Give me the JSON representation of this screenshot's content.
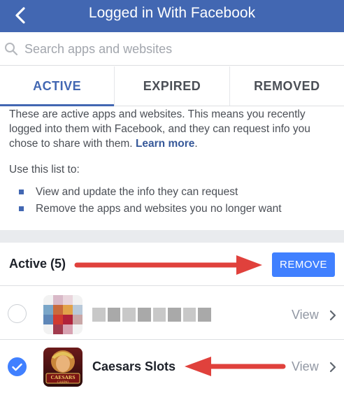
{
  "header": {
    "title": "Logged in With Facebook"
  },
  "search": {
    "placeholder": "Search apps and websites",
    "value": ""
  },
  "tabs": [
    {
      "label": "ACTIVE",
      "selected": true
    },
    {
      "label": "EXPIRED",
      "selected": false
    },
    {
      "label": "REMOVED",
      "selected": false
    }
  ],
  "intro": {
    "text": "These are active apps and websites. This means you recently logged into them with Facebook, and they can request info you chose to share with them.",
    "learn_more": "Learn more",
    "period": ".",
    "use_list_label": "Use this list to:",
    "bullets": [
      "View and update the info they can request",
      "Remove the apps and websites you no longer want"
    ]
  },
  "active_section": {
    "title": "Active (5)",
    "remove_label": "REMOVE"
  },
  "apps": [
    {
      "name": "",
      "view_label": "View",
      "checked": false,
      "icon": "pixelated-app-icon"
    },
    {
      "name": "Caesars Slots",
      "view_label": "View",
      "checked": true,
      "icon": "caesars-casino-icon",
      "icon_text": "CAESARS CASINO"
    }
  ],
  "colors": {
    "brand": "#4267b2",
    "button": "#4080ff",
    "arrow": "#e0413c",
    "muted": "#9197a3"
  },
  "icons": [
    "back-chevron-icon",
    "search-icon",
    "chevron-right-icon",
    "checkmark-icon"
  ]
}
